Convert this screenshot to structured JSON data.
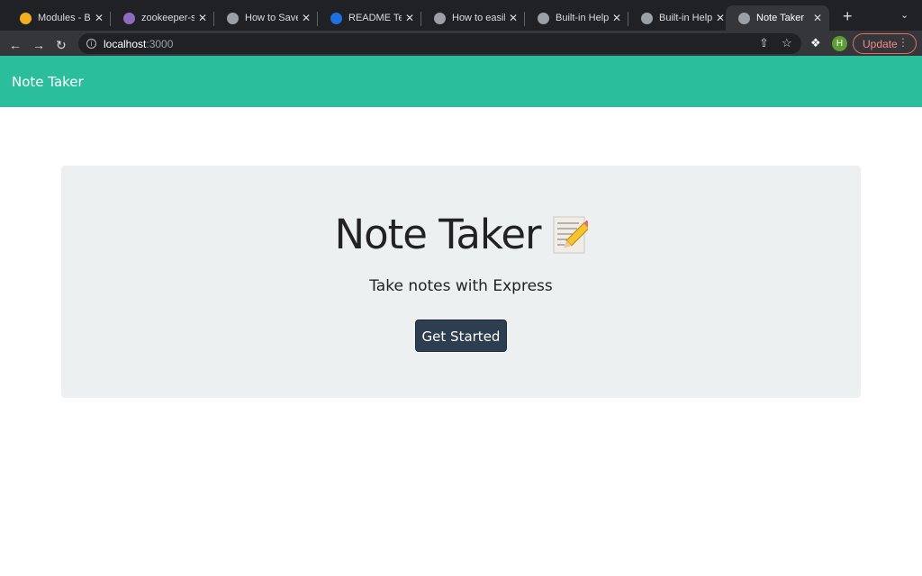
{
  "browser": {
    "tabs": [
      {
        "title": "Modules - Boo",
        "favicon": "#f2b01e"
      },
      {
        "title": "zookeeper-sto",
        "favicon": "#8e6bbf"
      },
      {
        "title": "How to Save H",
        "favicon": "#9aa0a6"
      },
      {
        "title": "README Temp",
        "favicon": "#1e6fe0"
      },
      {
        "title": "How to easily",
        "favicon": "#9aa0a6"
      },
      {
        "title": "Built-in Helpe",
        "favicon": "#9aa0a6"
      },
      {
        "title": "Built-in Helpe",
        "favicon": "#9aa0a6"
      },
      {
        "title": "Note Taker",
        "favicon": "#9aa0a6",
        "active": true
      }
    ],
    "url_host": "localhost",
    "url_port": ":3000",
    "avatar_letter": "H",
    "update_label": "Update"
  },
  "navbar": {
    "brand": "Note Taker",
    "color": "#2abe9c"
  },
  "hero": {
    "title": "Note Taker",
    "title_icon": "memo-emoji",
    "subtitle": "Take notes with Express",
    "button_label": "Get Started",
    "button_color": "#2c3e50"
  }
}
